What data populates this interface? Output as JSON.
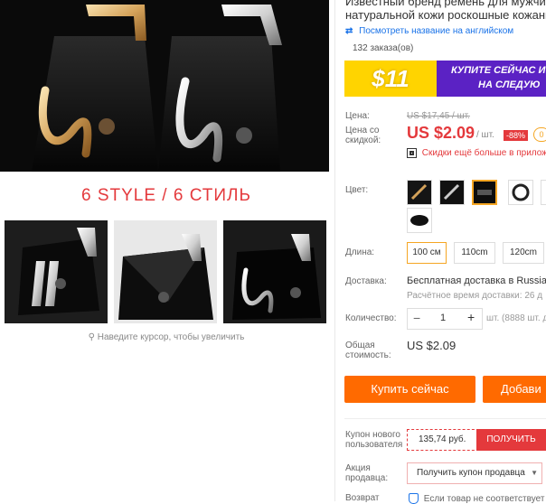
{
  "product": {
    "title_line1": "Известный бренд ремень для мужчин",
    "title_line2": "натуральной кожи роскошные кожаны",
    "translate_link": "Посмотреть название на английском",
    "orders": "132 заказа(ов)"
  },
  "banner": {
    "price": "$11",
    "line1": "КУПИТЕ СЕЙЧАС И",
    "line2": "НА СЛЕДУЮ"
  },
  "gallery": {
    "style_title": "6 STYLE / 6 СТИЛЬ",
    "zoom_hint": "Наведите курсор, чтобы увеличить"
  },
  "price": {
    "label": "Цена:",
    "old": "US $17,45 / шт.",
    "discount_label_1": "Цена со",
    "discount_label_2": "скидкой:",
    "current": "US $2.09",
    "unit": "/ шт.",
    "discount": "-88%",
    "badge": "0",
    "app_discount": "Скидки ещё больше в прилож"
  },
  "color": {
    "label": "Цвет:"
  },
  "length": {
    "label": "Длина:",
    "options": [
      "100 см",
      "110cm",
      "120cm"
    ],
    "selected": "100 см"
  },
  "delivery": {
    "label": "Доставка:",
    "value": "Бесплатная доставка в Russian",
    "eta": "Расчётное время доставки: 26 д"
  },
  "quantity": {
    "label": "Количество:",
    "minus": "−",
    "value": "1",
    "plus": "+",
    "available": "шт. (8888 шт. д"
  },
  "total": {
    "label_1": "Общая",
    "label_2": "стоимость:",
    "value": "US $2.09"
  },
  "actions": {
    "buy_now": "Купить сейчас",
    "add_to_cart": "Добави"
  },
  "coupons": {
    "new_user_label_1": "Купон нового",
    "new_user_label_2": "пользователя",
    "new_user_value": "135,74 руб.",
    "get_button": "ПОЛУЧИТЬ",
    "seller_label_1": "Акция",
    "seller_label_2": "продавца:",
    "seller_select": "Получить купон продавца",
    "return_label": "Возврат",
    "return_text": "Если товар не соответствует"
  },
  "colors": {
    "accent": "#ff6a00",
    "price_red": "#e4393c",
    "banner_purple": "#5b22c4",
    "banner_yellow": "#ffd400",
    "select_border": "#f5a623"
  }
}
